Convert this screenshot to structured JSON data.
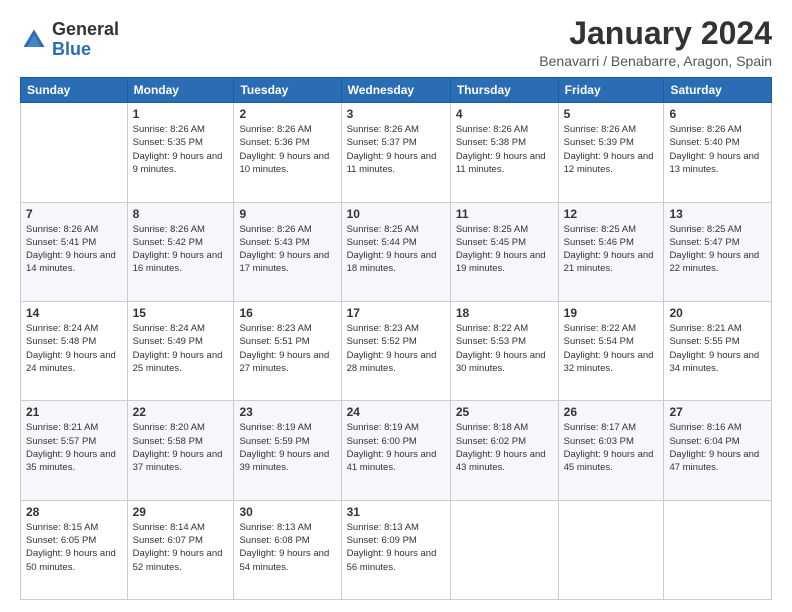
{
  "logo": {
    "general": "General",
    "blue": "Blue"
  },
  "title": "January 2024",
  "subtitle": "Benavarri / Benabarre, Aragon, Spain",
  "days_of_week": [
    "Sunday",
    "Monday",
    "Tuesday",
    "Wednesday",
    "Thursday",
    "Friday",
    "Saturday"
  ],
  "weeks": [
    [
      {
        "day": "",
        "sunrise": "",
        "sunset": "",
        "daylight": ""
      },
      {
        "day": "1",
        "sunrise": "Sunrise: 8:26 AM",
        "sunset": "Sunset: 5:35 PM",
        "daylight": "Daylight: 9 hours and 9 minutes."
      },
      {
        "day": "2",
        "sunrise": "Sunrise: 8:26 AM",
        "sunset": "Sunset: 5:36 PM",
        "daylight": "Daylight: 9 hours and 10 minutes."
      },
      {
        "day": "3",
        "sunrise": "Sunrise: 8:26 AM",
        "sunset": "Sunset: 5:37 PM",
        "daylight": "Daylight: 9 hours and 11 minutes."
      },
      {
        "day": "4",
        "sunrise": "Sunrise: 8:26 AM",
        "sunset": "Sunset: 5:38 PM",
        "daylight": "Daylight: 9 hours and 11 minutes."
      },
      {
        "day": "5",
        "sunrise": "Sunrise: 8:26 AM",
        "sunset": "Sunset: 5:39 PM",
        "daylight": "Daylight: 9 hours and 12 minutes."
      },
      {
        "day": "6",
        "sunrise": "Sunrise: 8:26 AM",
        "sunset": "Sunset: 5:40 PM",
        "daylight": "Daylight: 9 hours and 13 minutes."
      }
    ],
    [
      {
        "day": "7",
        "sunrise": "Sunrise: 8:26 AM",
        "sunset": "Sunset: 5:41 PM",
        "daylight": "Daylight: 9 hours and 14 minutes."
      },
      {
        "day": "8",
        "sunrise": "Sunrise: 8:26 AM",
        "sunset": "Sunset: 5:42 PM",
        "daylight": "Daylight: 9 hours and 16 minutes."
      },
      {
        "day": "9",
        "sunrise": "Sunrise: 8:26 AM",
        "sunset": "Sunset: 5:43 PM",
        "daylight": "Daylight: 9 hours and 17 minutes."
      },
      {
        "day": "10",
        "sunrise": "Sunrise: 8:25 AM",
        "sunset": "Sunset: 5:44 PM",
        "daylight": "Daylight: 9 hours and 18 minutes."
      },
      {
        "day": "11",
        "sunrise": "Sunrise: 8:25 AM",
        "sunset": "Sunset: 5:45 PM",
        "daylight": "Daylight: 9 hours and 19 minutes."
      },
      {
        "day": "12",
        "sunrise": "Sunrise: 8:25 AM",
        "sunset": "Sunset: 5:46 PM",
        "daylight": "Daylight: 9 hours and 21 minutes."
      },
      {
        "day": "13",
        "sunrise": "Sunrise: 8:25 AM",
        "sunset": "Sunset: 5:47 PM",
        "daylight": "Daylight: 9 hours and 22 minutes."
      }
    ],
    [
      {
        "day": "14",
        "sunrise": "Sunrise: 8:24 AM",
        "sunset": "Sunset: 5:48 PM",
        "daylight": "Daylight: 9 hours and 24 minutes."
      },
      {
        "day": "15",
        "sunrise": "Sunrise: 8:24 AM",
        "sunset": "Sunset: 5:49 PM",
        "daylight": "Daylight: 9 hours and 25 minutes."
      },
      {
        "day": "16",
        "sunrise": "Sunrise: 8:23 AM",
        "sunset": "Sunset: 5:51 PM",
        "daylight": "Daylight: 9 hours and 27 minutes."
      },
      {
        "day": "17",
        "sunrise": "Sunrise: 8:23 AM",
        "sunset": "Sunset: 5:52 PM",
        "daylight": "Daylight: 9 hours and 28 minutes."
      },
      {
        "day": "18",
        "sunrise": "Sunrise: 8:22 AM",
        "sunset": "Sunset: 5:53 PM",
        "daylight": "Daylight: 9 hours and 30 minutes."
      },
      {
        "day": "19",
        "sunrise": "Sunrise: 8:22 AM",
        "sunset": "Sunset: 5:54 PM",
        "daylight": "Daylight: 9 hours and 32 minutes."
      },
      {
        "day": "20",
        "sunrise": "Sunrise: 8:21 AM",
        "sunset": "Sunset: 5:55 PM",
        "daylight": "Daylight: 9 hours and 34 minutes."
      }
    ],
    [
      {
        "day": "21",
        "sunrise": "Sunrise: 8:21 AM",
        "sunset": "Sunset: 5:57 PM",
        "daylight": "Daylight: 9 hours and 35 minutes."
      },
      {
        "day": "22",
        "sunrise": "Sunrise: 8:20 AM",
        "sunset": "Sunset: 5:58 PM",
        "daylight": "Daylight: 9 hours and 37 minutes."
      },
      {
        "day": "23",
        "sunrise": "Sunrise: 8:19 AM",
        "sunset": "Sunset: 5:59 PM",
        "daylight": "Daylight: 9 hours and 39 minutes."
      },
      {
        "day": "24",
        "sunrise": "Sunrise: 8:19 AM",
        "sunset": "Sunset: 6:00 PM",
        "daylight": "Daylight: 9 hours and 41 minutes."
      },
      {
        "day": "25",
        "sunrise": "Sunrise: 8:18 AM",
        "sunset": "Sunset: 6:02 PM",
        "daylight": "Daylight: 9 hours and 43 minutes."
      },
      {
        "day": "26",
        "sunrise": "Sunrise: 8:17 AM",
        "sunset": "Sunset: 6:03 PM",
        "daylight": "Daylight: 9 hours and 45 minutes."
      },
      {
        "day": "27",
        "sunrise": "Sunrise: 8:16 AM",
        "sunset": "Sunset: 6:04 PM",
        "daylight": "Daylight: 9 hours and 47 minutes."
      }
    ],
    [
      {
        "day": "28",
        "sunrise": "Sunrise: 8:15 AM",
        "sunset": "Sunset: 6:05 PM",
        "daylight": "Daylight: 9 hours and 50 minutes."
      },
      {
        "day": "29",
        "sunrise": "Sunrise: 8:14 AM",
        "sunset": "Sunset: 6:07 PM",
        "daylight": "Daylight: 9 hours and 52 minutes."
      },
      {
        "day": "30",
        "sunrise": "Sunrise: 8:13 AM",
        "sunset": "Sunset: 6:08 PM",
        "daylight": "Daylight: 9 hours and 54 minutes."
      },
      {
        "day": "31",
        "sunrise": "Sunrise: 8:13 AM",
        "sunset": "Sunset: 6:09 PM",
        "daylight": "Daylight: 9 hours and 56 minutes."
      },
      {
        "day": "",
        "sunrise": "",
        "sunset": "",
        "daylight": ""
      },
      {
        "day": "",
        "sunrise": "",
        "sunset": "",
        "daylight": ""
      },
      {
        "day": "",
        "sunrise": "",
        "sunset": "",
        "daylight": ""
      }
    ]
  ]
}
